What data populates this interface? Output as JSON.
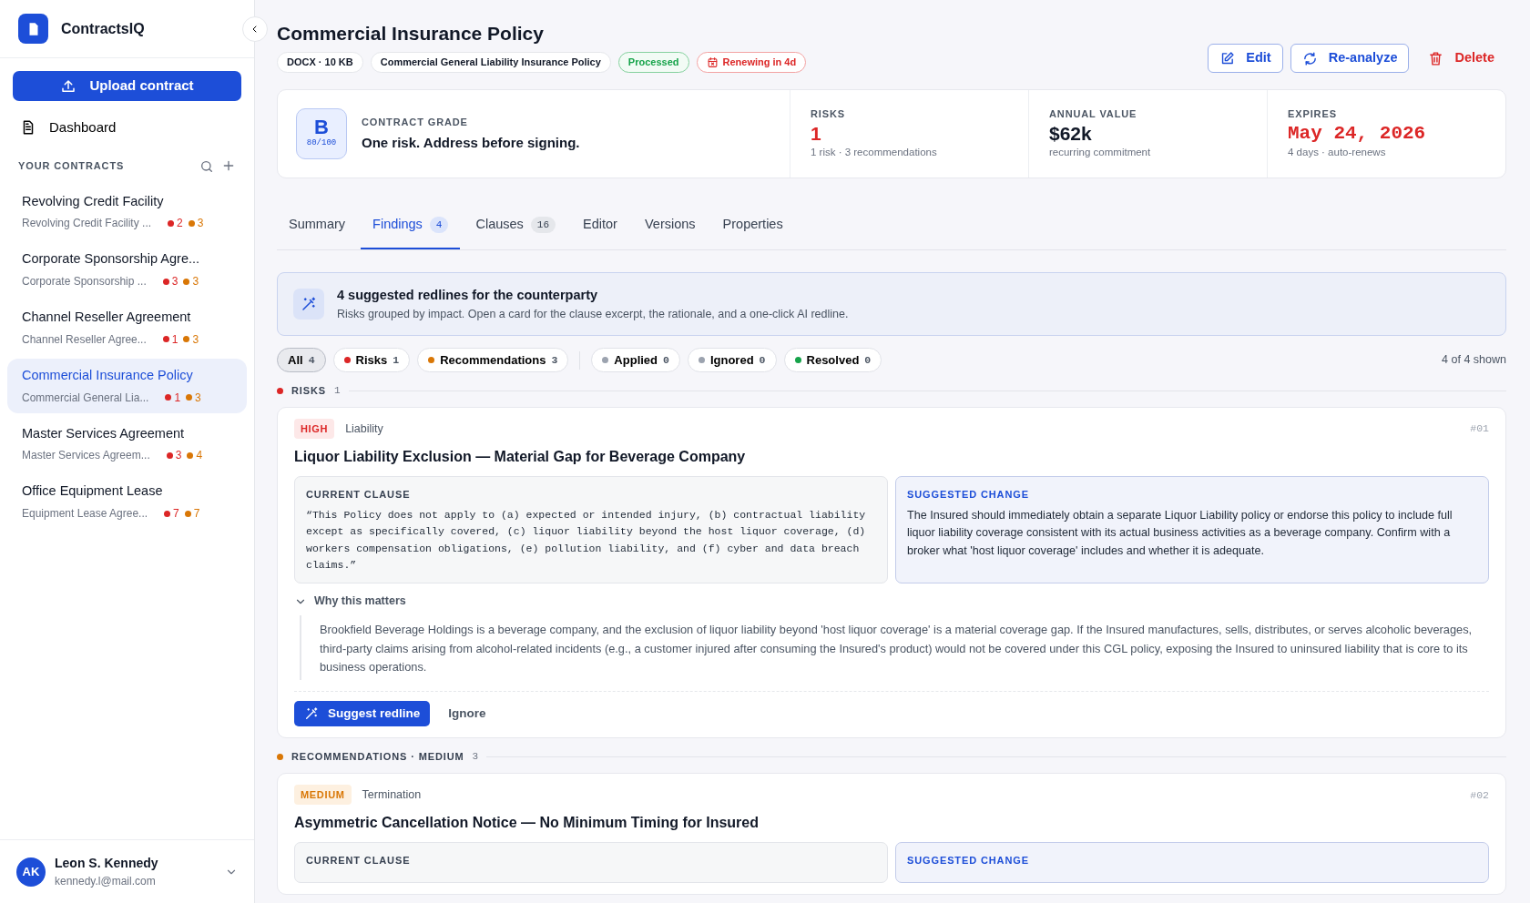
{
  "sidebar": {
    "brand": "ContractsIQ",
    "upload_button": "Upload contract",
    "nav": [
      {
        "label": "Dashboard",
        "selected": false
      }
    ],
    "section_label": "YOUR CONTRACTS",
    "contracts": [
      {
        "title": "Revolving Credit Facility",
        "subtitle": "Revolving Credit Facility ...",
        "risks": "2",
        "recommendations": "3",
        "selected": false
      },
      {
        "title": "Corporate Sponsorship Agre...",
        "subtitle": "Corporate Sponsorship ...",
        "risks": "3",
        "recommendations": "3",
        "selected": false
      },
      {
        "title": "Channel Reseller Agreement",
        "subtitle": "Channel Reseller Agree...",
        "risks": "1",
        "recommendations": "3",
        "selected": false
      },
      {
        "title": "Commercial Insurance Policy",
        "subtitle": "Commercial General Lia...",
        "risks": "1",
        "recommendations": "3",
        "selected": true
      },
      {
        "title": "Master Services Agreement",
        "subtitle": "Master Services Agreem...",
        "risks": "3",
        "recommendations": "4",
        "selected": false
      },
      {
        "title": "Office Equipment Lease",
        "subtitle": "Equipment Lease Agree...",
        "risks": "7",
        "recommendations": "7",
        "selected": false
      }
    ],
    "user": {
      "initials": "AK",
      "name": "Leon S. Kennedy",
      "email": "kennedy.l@mail.com"
    }
  },
  "header": {
    "title": "Commercial Insurance Policy",
    "tags": [
      {
        "text": "DOCX · 10 KB",
        "kind": "plain"
      },
      {
        "text": "Commercial General Liability Insurance Policy",
        "kind": "plain"
      },
      {
        "text": "Processed",
        "kind": "success"
      },
      {
        "text": "Renewing in 4d",
        "kind": "danger"
      }
    ],
    "actions": [
      {
        "label": "Edit",
        "kind": "edit"
      },
      {
        "label": "Re-analyze",
        "kind": "reanalyze"
      },
      {
        "label": "Delete",
        "kind": "delete"
      }
    ]
  },
  "summary": {
    "grade": {
      "letter": "B",
      "score": "80/100",
      "label": "CONTRACT GRADE",
      "text": "One risk. Address before signing."
    },
    "stats": [
      {
        "label": "RISKS",
        "value": "1",
        "note": "1 risk · 3 recommendations",
        "kind": "danger"
      },
      {
        "label": "ANNUAL VALUE",
        "value": "$62k",
        "note": "recurring commitment",
        "kind": "plain"
      },
      {
        "label": "EXPIRES",
        "value": "May 24, 2026",
        "note": "4 days · auto-renews",
        "kind": "danger-mono"
      }
    ]
  },
  "tabs": [
    {
      "label": "Summary",
      "selected": false
    },
    {
      "label": "Findings",
      "count": "4",
      "selected": true
    },
    {
      "label": "Clauses",
      "count": "16",
      "selected": false
    },
    {
      "label": "Editor",
      "selected": false
    },
    {
      "label": "Versions",
      "selected": false
    },
    {
      "label": "Properties",
      "selected": false
    }
  ],
  "banner": {
    "title": "4 suggested redlines for the counterparty",
    "text": "Risks grouped by impact. Open a card for the clause excerpt, the rationale, and a one-click AI redline."
  },
  "filters": [
    {
      "label": "All",
      "count": "4",
      "selected": true
    },
    {
      "label": "Risks",
      "count": "1",
      "color": "#dc2626",
      "selected": false
    },
    {
      "label": "Recommendations",
      "count": "3",
      "color": "#d97706",
      "selected": false
    },
    {
      "label": "Applied",
      "count": "0",
      "color": "#9ca3af",
      "selected": false,
      "separator_before": true
    },
    {
      "label": "Ignored",
      "count": "0",
      "color": "#9ca3af",
      "selected": false
    },
    {
      "label": "Resolved",
      "count": "0",
      "color": "#16a34a",
      "selected": false
    }
  ],
  "shown": "4 of 4 shown",
  "groups": [
    {
      "label": "RISKS",
      "count": "1",
      "color": "#dc2626",
      "findings": [
        {
          "severity": "HIGH",
          "kind": "high",
          "category": "Liability",
          "number": "#01",
          "title": "Liquor Liability Exclusion — Material Gap for Beverage Company",
          "current_label": "CURRENT CLAUSE",
          "current_clause": "“This Policy does not apply to (a) expected or intended injury, (b) contractual liability except as specifically covered, (c) liquor liability beyond the host liquor coverage, (d) workers compensation obligations, (e) pollution liability, and (f) cyber and data breach claims.”",
          "suggested_label": "SUGGESTED CHANGE",
          "suggested_change": "The Insured should immediately obtain a separate Liquor Liability policy or endorse this policy to include full liquor liability coverage consistent with its actual business activities as a beverage company. Confirm with a broker what 'host liquor coverage' includes and whether it is adequate.",
          "why_label": "Why this matters",
          "expanded": true,
          "why_text": "Brookfield Beverage Holdings is a beverage company, and the exclusion of liquor liability beyond 'host liquor coverage' is a material coverage gap. If the Insured manufactures, sells, distributes, or serves alcoholic beverages, third-party claims arising from alcohol-related incidents (e.g., a customer injured after consuming the Insured's product) would not be covered under this CGL policy, exposing the Insured to uninsured liability that is core to its business operations.",
          "primary_action": "Suggest redline",
          "secondary_action": "Ignore"
        }
      ]
    },
    {
      "label": "RECOMMENDATIONS · MEDIUM",
      "count": "3",
      "color": "#d97706",
      "findings": [
        {
          "severity": "MEDIUM",
          "kind": "medium",
          "category": "Termination",
          "number": "#02",
          "title": "Asymmetric Cancellation Notice — No Minimum Timing for Insured",
          "current_label": "CURRENT CLAUSE",
          "suggested_label": "SUGGESTED CHANGE"
        }
      ]
    }
  ]
}
